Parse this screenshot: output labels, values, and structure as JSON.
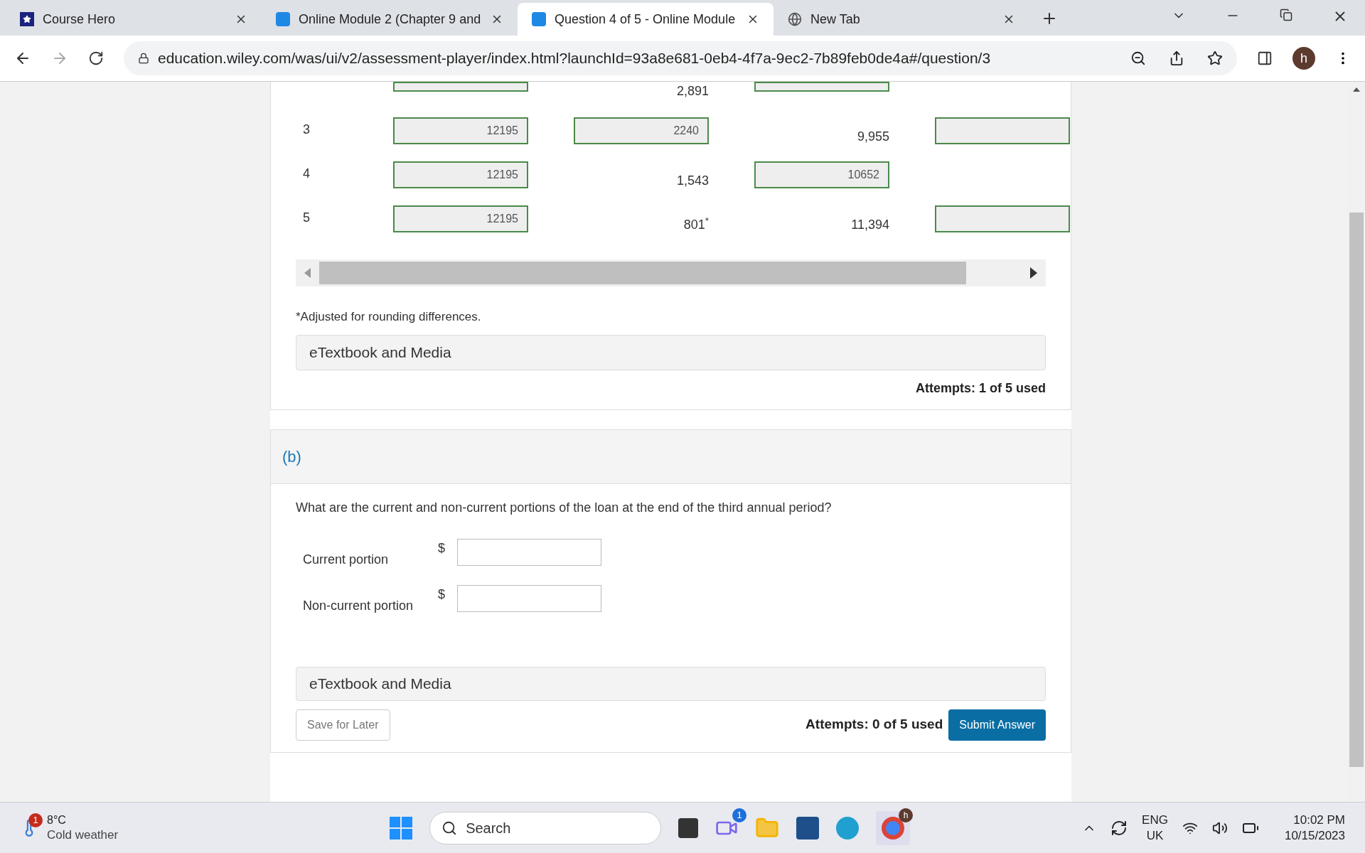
{
  "browser": {
    "tabs": [
      {
        "title": "Course Hero",
        "selected": false
      },
      {
        "title": "Online Module 2 (Chapter 9 and",
        "selected": false
      },
      {
        "title": "Question 4 of 5 - Online Module",
        "selected": true
      },
      {
        "title": "New Tab",
        "selected": false
      }
    ],
    "url": "education.wiley.com/was/ui/v2/assessment-player/index.html?launchId=93a8e681-0eb4-4f7a-9ec2-7b89feb0de4a#/question/3",
    "profile": "h"
  },
  "table": {
    "rows": [
      {
        "cells": [
          {
            "kind": "input"
          },
          {
            "kind": "text",
            "value": "2,891"
          },
          {
            "kind": "input"
          },
          {
            "kind": "none"
          }
        ]
      },
      {
        "label": "3",
        "cells": [
          {
            "kind": "input",
            "value": "12195"
          },
          {
            "kind": "input",
            "value": "2240"
          },
          {
            "kind": "text",
            "value": "9,955"
          },
          {
            "kind": "input"
          }
        ]
      },
      {
        "label": "4",
        "cells": [
          {
            "kind": "input",
            "value": "12195"
          },
          {
            "kind": "text",
            "value": "1,543"
          },
          {
            "kind": "input",
            "value": "10652"
          },
          {
            "kind": "none"
          }
        ]
      },
      {
        "label": "5",
        "cells": [
          {
            "kind": "input",
            "value": "12195"
          },
          {
            "kind": "text",
            "value": "801$^{*}$"
          },
          {
            "kind": "text",
            "value": "11,394"
          },
          {
            "kind": "input"
          }
        ]
      }
    ],
    "footnote": "*Adjusted for rounding differences.",
    "etextbook": "eTextbook and Media",
    "attempts": "Attempts: 1 of 5 used"
  },
  "part_b": {
    "label": "(b)",
    "question": "What are the current and non-current portions of the loan at the end of the third annual period?",
    "fields": [
      {
        "label": "Current portion",
        "currency": "$"
      },
      {
        "label": "Non-current portion",
        "currency": "$"
      }
    ],
    "etextbook": "eTextbook and Media",
    "save_button": "Save for Later",
    "attempts": "Attempts: 0 of 5 used",
    "submit_button": "Submit Answer"
  },
  "taskbar": {
    "weather_badge": "1",
    "temperature": "8°C",
    "weather": "Cold weather",
    "search_placeholder": "Search",
    "teams_badge": "1",
    "chrome_badge": "h",
    "language": "ENG",
    "region": "UK",
    "time": "10:02 PM",
    "date": "10/15/2023"
  }
}
